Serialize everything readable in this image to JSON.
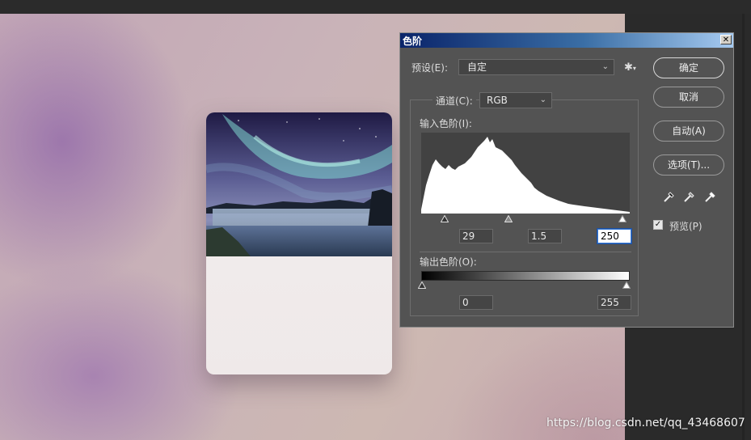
{
  "dialog": {
    "title": "色阶",
    "preset_label": "预设(E):",
    "preset_value": "自定",
    "channel_label": "通道(C):",
    "channel_value": "RGB",
    "input_levels_label": "输入色阶(I):",
    "input_black": "29",
    "input_gamma": "1.5",
    "input_white": "250",
    "output_levels_label": "输出色阶(O):",
    "output_black": "0",
    "output_white": "255",
    "buttons": {
      "ok": "确定",
      "cancel": "取消",
      "auto": "自动(A)",
      "options": "选项(T)..."
    },
    "preview_label": "预览(P)",
    "preview_checked": true,
    "close_glyph": "✕"
  },
  "icons": {
    "gear": "gear-icon",
    "dropdown": "chevron-down-icon",
    "black_point": "eyedropper-black-icon",
    "gray_point": "eyedropper-gray-icon",
    "white_point": "eyedropper-white-icon"
  },
  "watermark": "https://blog.csdn.net/qq_43468607",
  "colors": {
    "dialog_bg": "#535353",
    "titlebar_start": "#0a246a",
    "titlebar_end": "#a6caf0",
    "field_focus": "#3b7bd4"
  }
}
